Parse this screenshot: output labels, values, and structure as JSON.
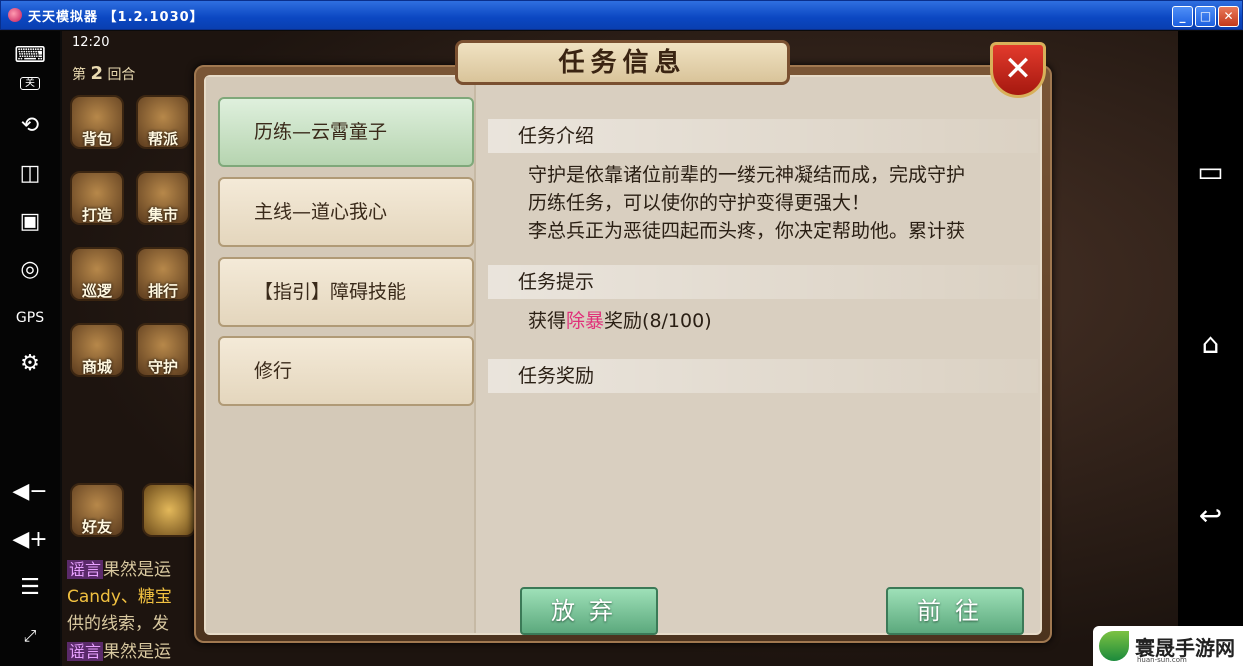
{
  "window": {
    "title": "天天模拟器 【1.2.1030】",
    "min_label": "_",
    "max_label": "□",
    "close_label": "✕"
  },
  "left_toolbar": {
    "toggle_label": "关",
    "gps_label": "GPS"
  },
  "game": {
    "time": "12:20",
    "turn_prefix": "第",
    "turn_number": "2",
    "turn_suffix": "回合",
    "icons": [
      "背包",
      "帮派",
      "打造",
      "集市",
      "巡逻",
      "排行",
      "商城",
      "守护"
    ],
    "friends_label": "好友",
    "chat": [
      {
        "tag": "谣言",
        "text": "果然是运"
      },
      {
        "tag": "",
        "text": "Candy、糖宝"
      },
      {
        "tag": "",
        "text": "供的线索，发"
      },
      {
        "tag": "谣言",
        "text": "果然是运"
      }
    ]
  },
  "dialog": {
    "title": "任务信息",
    "close_label": "✕",
    "quests": [
      "历练—云霄童子",
      "主线—道心我心",
      "【指引】障碍技能",
      "修行"
    ],
    "selected_index": 0,
    "intro_heading": "任务介绍",
    "intro_lines": [
      "守护是依靠诸位前辈的一缕元神凝结而成，完成守护",
      "历练任务，可以使你的守护变得更强大！",
      "李总兵正为恶徒四起而头疼，你决定帮助他。累计获"
    ],
    "hint_heading": "任务提示",
    "hint_prefix": "获得",
    "hint_highlight": "除暴",
    "hint_suffix": "奖励(8/100)",
    "reward_heading": "任务奖励",
    "abandon_label": "放弃",
    "goto_label": "前往"
  },
  "watermark": {
    "name": "寰晟手游网",
    "url": "huan-sun.com"
  }
}
